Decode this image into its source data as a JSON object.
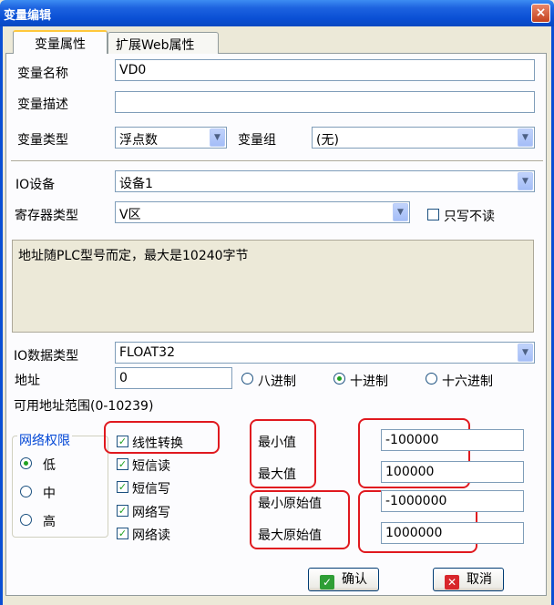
{
  "window": {
    "title": "变量编辑",
    "close_glyph": "×"
  },
  "tabs": [
    {
      "label": "变量属性",
      "active": true
    },
    {
      "label": "扩展Web属性",
      "active": false
    }
  ],
  "form": {
    "var_name_label": "变量名称",
    "var_name_value": "VD0",
    "var_desc_label": "变量描述",
    "var_desc_value": "",
    "var_type_label": "变量类型",
    "var_type_value": "浮点数",
    "var_group_label": "变量组",
    "var_group_value": "(无)",
    "io_device_label": "IO设备",
    "io_device_value": "设备1",
    "register_type_label": "寄存器类型",
    "register_type_value": "V区",
    "write_only_label": "只写不读",
    "write_only_checked": false,
    "hint_text": "地址随PLC型号而定，最大是10240字节",
    "io_data_type_label": "IO数据类型",
    "io_data_type_value": "FLOAT32",
    "address_label": "地址",
    "address_value": "0",
    "radix_octal": "八进制",
    "radix_decimal": "十进制",
    "radix_hex": "十六进制",
    "radix_selected": "十进制",
    "address_range": "可用地址范围(0-10239)"
  },
  "network_permission": {
    "title": "网络权限",
    "options": [
      "低",
      "中",
      "高"
    ],
    "selected": "低"
  },
  "checkboxes": [
    {
      "label": "线性转换",
      "checked": true
    },
    {
      "label": "短信读",
      "checked": true
    },
    {
      "label": "短信写",
      "checked": true
    },
    {
      "label": "网络写",
      "checked": true
    },
    {
      "label": "网络读",
      "checked": true
    }
  ],
  "scaling": {
    "min_label": "最小值",
    "min_value": "-100000",
    "max_label": "最大值",
    "max_value": "100000",
    "raw_min_label": "最小原始值",
    "raw_min_value": "-1000000",
    "raw_max_label": "最大原始值",
    "raw_max_value": "1000000"
  },
  "buttons": {
    "ok_label": "确认",
    "cancel_label": "取消"
  },
  "colors": {
    "title_bar": "#0a4fd4",
    "highlight_border": "#e0191f",
    "check_mark": "#21a121",
    "group_title": "#0046d5"
  },
  "icons": {
    "dropdown": "chevron-down-icon",
    "check": "check-icon",
    "ok": "checkmark-icon",
    "cancel": "x-icon"
  }
}
